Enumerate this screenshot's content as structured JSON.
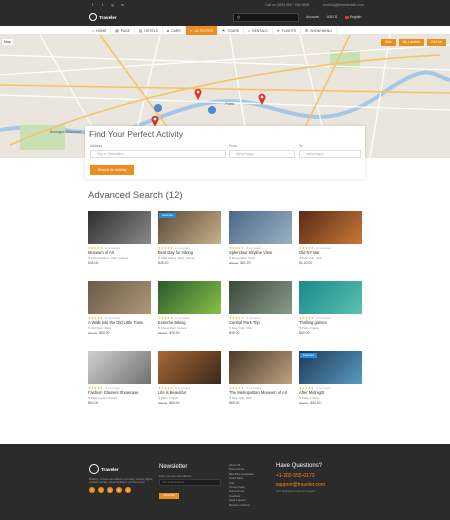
{
  "topbar": {
    "social": [
      "f",
      "t",
      "g",
      "in"
    ],
    "phone": "Call us (555) 555 - 555 5555",
    "email": "booking@travelersite.com"
  },
  "header": {
    "logo": "Traveler",
    "account": "Account",
    "currency": "USD $",
    "language": "English"
  },
  "nav": {
    "items": [
      {
        "label": "HOME",
        "icon": "home-icon",
        "active": false
      },
      {
        "label": "PAGE",
        "icon": "page-icon",
        "active": false
      },
      {
        "label": "HOTELS",
        "icon": "hotel-icon",
        "active": false
      },
      {
        "label": "CARS",
        "icon": "car-icon",
        "active": false
      },
      {
        "label": "ACTIVITIES",
        "icon": "activity-icon",
        "active": true
      },
      {
        "label": "TOURS",
        "icon": "tour-icon",
        "active": false
      },
      {
        "label": "RENTALS",
        "icon": "rental-icon",
        "active": false
      },
      {
        "label": "FLIGHTS",
        "icon": "flight-icon",
        "active": false
      },
      {
        "label": "SHOW MENU",
        "icon": "menu-icon",
        "active": false
      }
    ]
  },
  "map": {
    "type_label": "Map",
    "buttons": [
      "Hide",
      "My Location",
      "Exit full"
    ],
    "place_labels": [
      "Paris",
      "Boulogne-Billancourt"
    ]
  },
  "search_panel": {
    "title": "Find Your Perfect Activity",
    "address_label": "Address",
    "address_placeholder": "City or Destination",
    "from_label": "From",
    "from_placeholder": "dd/mm/yyyy",
    "to_label": "To",
    "to_placeholder": "dd/mm/yyyy",
    "button": "Search for Activity"
  },
  "results": {
    "title": "Advanced Search (12)",
    "stars": "★★★★★",
    "items": [
      {
        "title": "Museum of Art",
        "location": "Paris Museum, Paris, France",
        "old_price": "",
        "price": "$45.00",
        "reviews": "4 reviews",
        "featured": false,
        "color": "#2e2e2e",
        "color2": "#8a8a8a"
      },
      {
        "title": "Best Day for Hiking",
        "location": "Walk Hiking, Paris, France",
        "old_price": "",
        "price": "$45.20",
        "reviews": "4 reviews",
        "featured": true,
        "color": "#5a4a38",
        "color2": "#c9b08a"
      },
      {
        "title": "Splendour Skyline View",
        "location": "Montmartre, Paris",
        "old_price": "$88.00",
        "price": "$61.20",
        "reviews": "3 reviews",
        "featured": false,
        "color": "#4a6a8a",
        "color2": "#9ab0c0"
      },
      {
        "title": "Old NY Bar",
        "location": "New York, USA",
        "old_price": "",
        "price": "$1,20.00",
        "reviews": "4 reviews",
        "featured": false,
        "color": "#5a2a18",
        "color2": "#c87838"
      },
      {
        "title": "A Walk into the Old Little Town",
        "location": "Old Town, Paris",
        "old_price": "$69.00",
        "price": "$50.00",
        "reviews": "4 reviews",
        "featured": false,
        "color": "#6a5a48",
        "color2": "#b09878"
      },
      {
        "title": "Extreme Biking",
        "location": "Forest Park, France",
        "old_price": "$84.00",
        "price": "$76.00",
        "reviews": "4 reviews",
        "featured": false,
        "color": "#2a5a2a",
        "color2": "#8ac04a"
      },
      {
        "title": "Central Park Trip",
        "location": "New York, USA",
        "old_price": "",
        "price": "$45.00",
        "reviews": "4 reviews",
        "featured": false,
        "color": "#3a4a3a",
        "color2": "#8a9a8a"
      },
      {
        "title": "Thrilling games",
        "location": "Paris, France",
        "old_price": "",
        "price": "$60.00",
        "reviews": "4 reviews",
        "featured": false,
        "color": "#1a8a8a",
        "color2": "#5ac0b0"
      },
      {
        "title": "Fashion Glasses Showcase",
        "location": "Paris Center, France",
        "old_price": "",
        "price": "$64.00",
        "reviews": "4 reviews",
        "featured": false,
        "color": "#d0d0d0",
        "color2": "#707070"
      },
      {
        "title": "Life is Beautiful",
        "location": "Paris, France",
        "old_price": "$68.00",
        "price": "$66.00",
        "reviews": "4 reviews",
        "featured": false,
        "color": "#a86838",
        "color2": "#3a2818"
      },
      {
        "title": "The Metropolitan Museum of Art",
        "location": "New York, USA",
        "old_price": "",
        "price": "$65.00",
        "reviews": "4 reviews",
        "featured": false,
        "color": "#4a3a2a",
        "color2": "#c0a080"
      },
      {
        "title": "After Midnight",
        "location": "Paris, France",
        "old_price": "$69.00",
        "price": "$54.00",
        "reviews": "4 reviews",
        "featured": true,
        "color": "#1a3a5a",
        "color2": "#5a9ac0"
      }
    ],
    "featured_label": "Featured"
  },
  "footer": {
    "logo": "Traveler",
    "description": "Booking, reviews and advices on hotels, resorts, flights, vacation rentals, travel packages, and lots more!",
    "social": [
      "f",
      "t",
      "g",
      "in",
      "p"
    ],
    "newsletter_title": "Newsletter",
    "newsletter_sub": "Enter your E-mail Address",
    "newsletter_placeholder": "Your email address",
    "newsletter_button": "Subscribe",
    "links": [
      "About US",
      "Press Centre",
      "Best Price Guarantee",
      "Travel News",
      "Jobs",
      "Privacy Policy",
      "Terms of Use",
      "Feedback",
      "Need a quote?",
      "Become a Partner"
    ],
    "questions_title": "Have Questions?",
    "phone": "+1-202-555-0173",
    "email": "support@traveler.com",
    "sub": "24/7 Dedicated Customer Support"
  },
  "colors": {
    "accent": "#ec8d20",
    "dark": "#2b2b2b",
    "badge": "#2a8ad8"
  }
}
